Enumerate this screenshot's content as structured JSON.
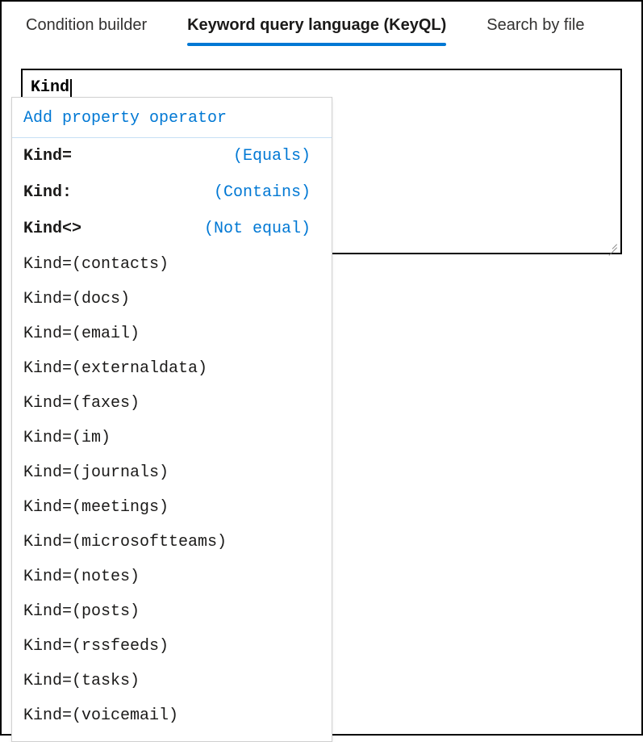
{
  "tabs": [
    {
      "label": "Condition builder",
      "active": false
    },
    {
      "label": "Keyword query language (KeyQL)",
      "active": true
    },
    {
      "label": "Search by file",
      "active": false
    }
  ],
  "query": {
    "value": "Kind"
  },
  "dropdown": {
    "header": "Add property operator",
    "operators": [
      {
        "key": "Kind=",
        "desc": "(Equals)"
      },
      {
        "key": "Kind:",
        "desc": "(Contains)"
      },
      {
        "key": "Kind<>",
        "desc": "(Not equal)"
      }
    ],
    "values": [
      "Kind=(contacts)",
      "Kind=(docs)",
      "Kind=(email)",
      "Kind=(externaldata)",
      "Kind=(faxes)",
      "Kind=(im)",
      "Kind=(journals)",
      "Kind=(meetings)",
      "Kind=(microsoftteams)",
      "Kind=(notes)",
      "Kind=(posts)",
      "Kind=(rssfeeds)",
      "Kind=(tasks)",
      "Kind=(voicemail)"
    ]
  }
}
